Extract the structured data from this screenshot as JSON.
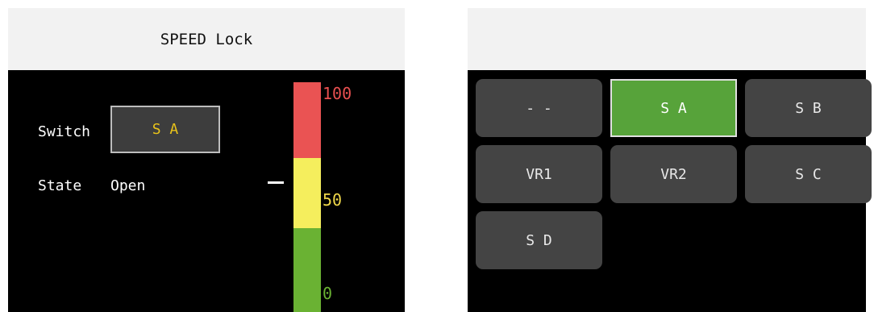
{
  "left_panel": {
    "header": "SPEED Lock",
    "switch_label": "Switch",
    "switch_value": "S A",
    "state_label": "State",
    "state_value": "Open",
    "gauge": {
      "ticks": [
        "100",
        "50",
        "0"
      ],
      "marker_level_percent": 57,
      "colors": {
        "high": "#ea5353",
        "mid": "#f5ee5d",
        "low": "#6ab233"
      }
    }
  },
  "right_panel": {
    "header": "",
    "buttons": [
      {
        "label": "- -",
        "selected": false
      },
      {
        "label": "S A",
        "selected": true
      },
      {
        "label": "S B",
        "selected": false
      },
      {
        "label": "VR1",
        "selected": false
      },
      {
        "label": "VR2",
        "selected": false
      },
      {
        "label": "S C",
        "selected": false
      },
      {
        "label": "S D",
        "selected": false
      }
    ]
  },
  "colors": {
    "selected_button": "#57a33a",
    "button": "#444444",
    "switch_value_text": "#e9c31a"
  }
}
